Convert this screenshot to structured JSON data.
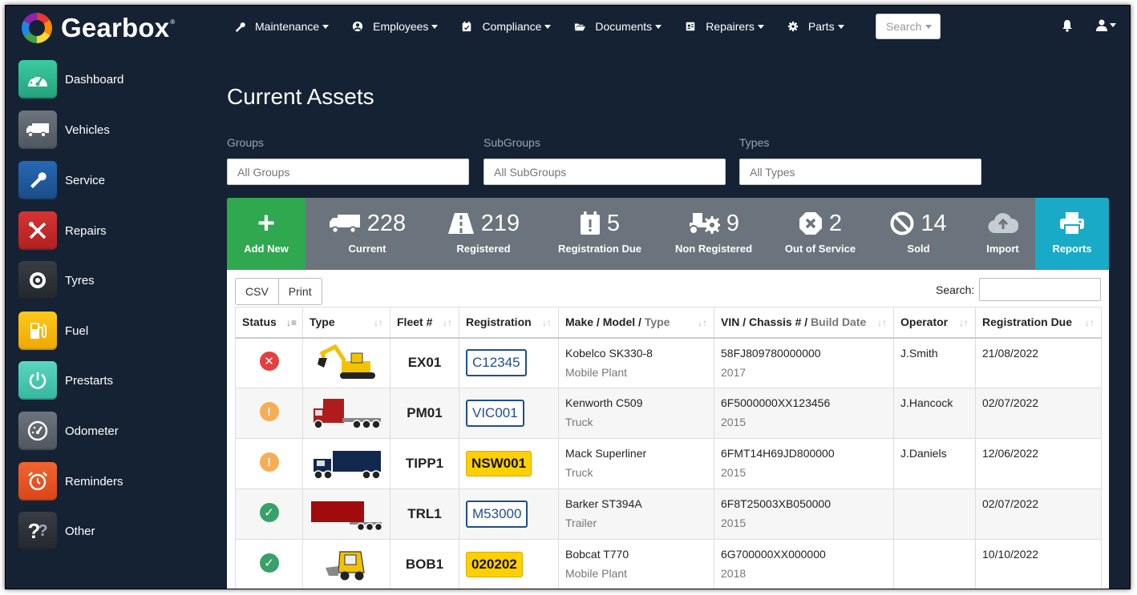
{
  "app": {
    "name": "Gearbox",
    "tm": "®"
  },
  "nav": {
    "items": [
      {
        "label": "Maintenance",
        "icon": "wrench-icon"
      },
      {
        "label": "Employees",
        "icon": "user-circle-icon"
      },
      {
        "label": "Compliance",
        "icon": "calendar-check-icon"
      },
      {
        "label": "Documents",
        "icon": "folder-open-icon"
      },
      {
        "label": "Repairers",
        "icon": "id-card-icon"
      },
      {
        "label": "Parts",
        "icon": "gear-icon"
      }
    ],
    "search_label": "Search"
  },
  "sidebar": {
    "items": [
      {
        "label": "Dashboard",
        "color": "#2bb38b"
      },
      {
        "label": "Vehicles",
        "color": "#5a626b"
      },
      {
        "label": "Service",
        "color": "#1f5a9e"
      },
      {
        "label": "Repairs",
        "color": "#c62828"
      },
      {
        "label": "Tyres",
        "color": "#2b2f35"
      },
      {
        "label": "Fuel",
        "color": "#f5b800"
      },
      {
        "label": "Prestarts",
        "color": "#45c7b0"
      },
      {
        "label": "Odometer",
        "color": "#5a626b"
      },
      {
        "label": "Reminders",
        "color": "#e8541c"
      },
      {
        "label": "Other",
        "color": "#2b2f35"
      }
    ]
  },
  "page": {
    "title": "Current Assets"
  },
  "filters": {
    "groups_label": "Groups",
    "groups_placeholder": "All Groups",
    "subgroups_label": "SubGroups",
    "subgroups_placeholder": "All SubGroups",
    "types_label": "Types",
    "types_placeholder": "All Types"
  },
  "stats": {
    "add_new": "Add New",
    "current": {
      "value": "228",
      "label": "Current"
    },
    "registered": {
      "value": "219",
      "label": "Registered"
    },
    "registration_due": {
      "value": "5",
      "label": "Registration Due"
    },
    "non_registered": {
      "value": "9",
      "label": "Non Registered"
    },
    "out_of_service": {
      "value": "2",
      "label": "Out of Service"
    },
    "sold": {
      "value": "14",
      "label": "Sold"
    },
    "import": "Import",
    "reports": "Reports"
  },
  "table_tools": {
    "csv": "CSV",
    "print": "Print",
    "search_label": "Search:"
  },
  "table": {
    "headers": {
      "status": "Status",
      "type": "Type",
      "fleet": "Fleet #",
      "registration": "Registration",
      "make": "Make / Model /",
      "make_sub": "Type",
      "vin": "VIN / Chassis # /",
      "vin_sub": "Build Date",
      "operator": "Operator",
      "reg_due": "Registration Due"
    },
    "rows": [
      {
        "status": "error",
        "fleet": "EX01",
        "reg": "C12345",
        "plate": "blue",
        "make": "Kobelco SK330-8",
        "type": "Mobile Plant",
        "vin": "58FJ809780000000",
        "year": "2017",
        "operator": "J.Smith",
        "due": "21/08/2022",
        "vehicle": "excavator"
      },
      {
        "status": "warning",
        "fleet": "PM01",
        "reg": "VIC001",
        "plate": "blue",
        "make": "Kenworth C509",
        "type": "Truck",
        "vin": "6F5000000XX123456",
        "year": "2015",
        "operator": "J.Hancock",
        "due": "02/07/2022",
        "vehicle": "prime-mover"
      },
      {
        "status": "warning",
        "fleet": "TIPP1",
        "reg": "NSW001",
        "plate": "yellow",
        "make": "Mack Superliner",
        "type": "Truck",
        "vin": "6FMT14H69JD800000",
        "year": "2015",
        "operator": "J.Daniels",
        "due": "12/06/2022",
        "vehicle": "semi-truck"
      },
      {
        "status": "ok",
        "fleet": "TRL1",
        "reg": "M53000",
        "plate": "blue",
        "make": "Barker ST394A",
        "type": "Trailer",
        "vin": "6F8T25003XB050000",
        "year": "2015",
        "operator": "",
        "due": "02/07/2022",
        "vehicle": "trailer"
      },
      {
        "status": "ok",
        "fleet": "BOB1",
        "reg": "020202",
        "plate": "yellow",
        "make": "Bobcat T770",
        "type": "Mobile Plant",
        "vin": "6G700000XX000000",
        "year": "2018",
        "operator": "",
        "due": "10/10/2022",
        "vehicle": "skid-steer"
      }
    ]
  },
  "colors": {
    "bg": "#152234",
    "add": "#2fa84f",
    "reports": "#19aac8",
    "statbar": "#6b747d",
    "error": "#e53e3e",
    "warning": "#f6ad55",
    "ok": "#38a169"
  }
}
